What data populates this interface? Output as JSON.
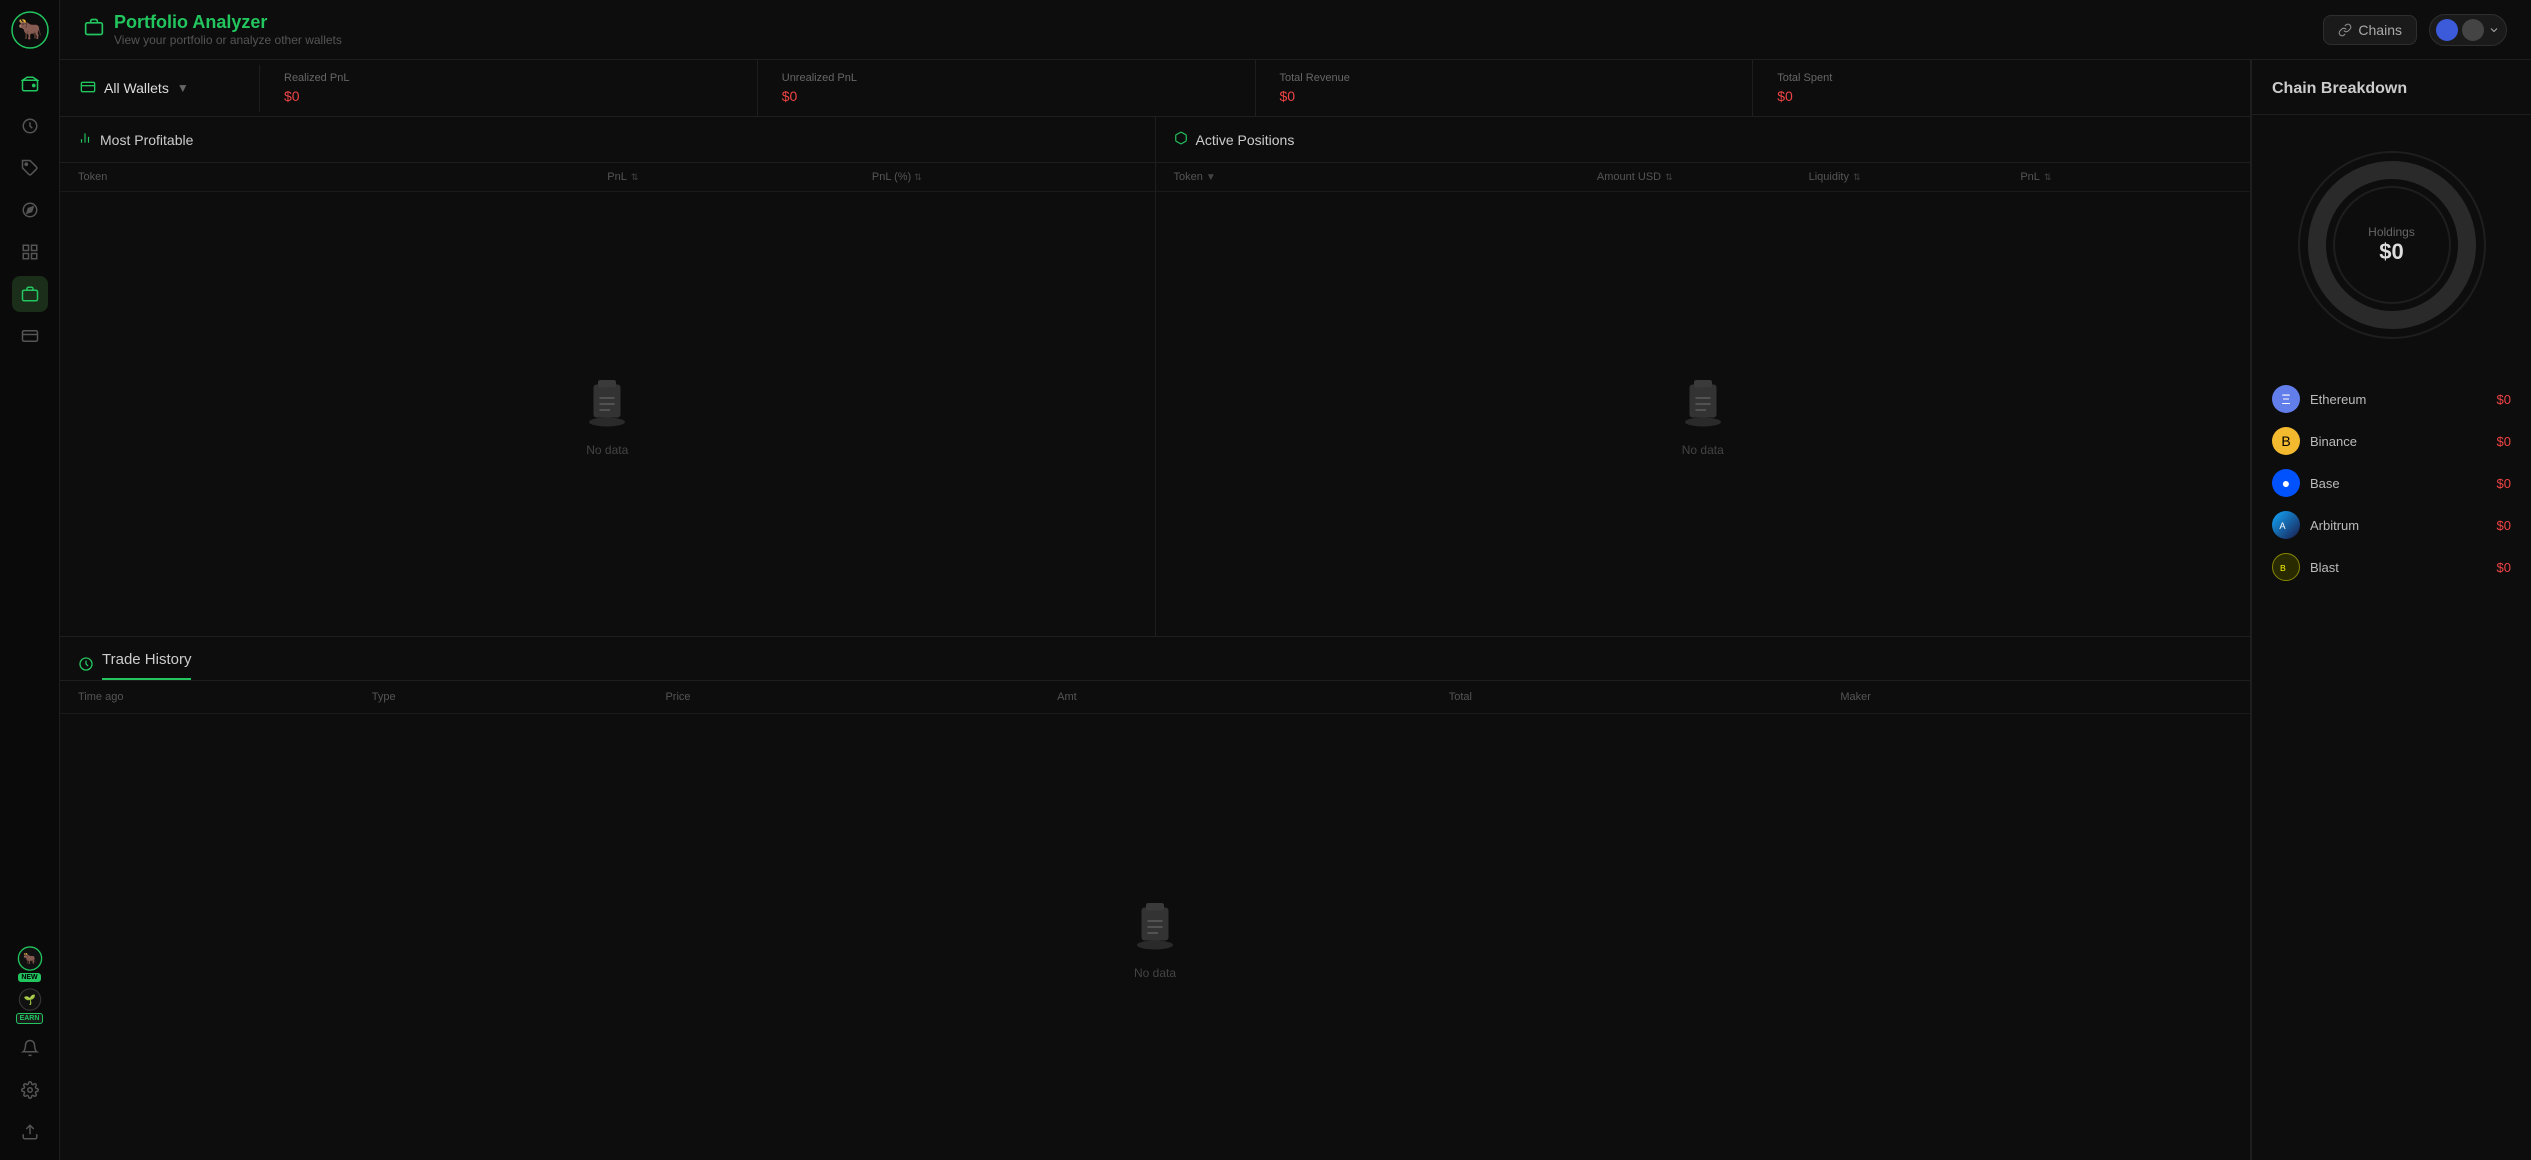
{
  "app": {
    "logo_alt": "Bull logo"
  },
  "sidebar": {
    "items": [
      {
        "id": "wallet",
        "icon": "💳",
        "label": "Wallet"
      },
      {
        "id": "history",
        "icon": "🕐",
        "label": "History"
      },
      {
        "id": "tag",
        "icon": "🏷️",
        "label": "Tag"
      },
      {
        "id": "compass",
        "icon": "🧭",
        "label": "Compass"
      },
      {
        "id": "crop",
        "icon": "⊞",
        "label": "Crop"
      },
      {
        "id": "briefcase",
        "icon": "💼",
        "label": "Briefcase",
        "active": true
      },
      {
        "id": "card",
        "icon": "🪪",
        "label": "Card"
      },
      {
        "id": "new-feature",
        "badge": "NEW",
        "icon": "🐂"
      },
      {
        "id": "earn-feature",
        "badge": "EARN",
        "icon": "🌱"
      },
      {
        "id": "bell",
        "icon": "🔔",
        "label": "Bell"
      },
      {
        "id": "settings",
        "icon": "⚙️",
        "label": "Settings"
      },
      {
        "id": "export",
        "icon": "📤",
        "label": "Export"
      }
    ]
  },
  "header": {
    "title": "Portfolio Analyzer",
    "subtitle": "View your portfolio or analyze other wallets",
    "chains_button": "Chains",
    "icon_alt": "portfolio-icon"
  },
  "wallet_bar": {
    "wallet_label": "All Wallets",
    "stats": [
      {
        "label": "Realized PnL",
        "value": "$0"
      },
      {
        "label": "Unrealized PnL",
        "value": "$0"
      },
      {
        "label": "Total Revenue",
        "value": "$0"
      },
      {
        "label": "Total Spent",
        "value": "$0"
      }
    ]
  },
  "most_profitable": {
    "title": "Most Profitable",
    "columns": [
      {
        "key": "token",
        "label": "Token"
      },
      {
        "key": "pnl",
        "label": "PnL",
        "sortable": true
      },
      {
        "key": "pnlpct",
        "label": "PnL (%)",
        "sortable": true
      }
    ],
    "no_data": "No data"
  },
  "active_positions": {
    "title": "Active Positions",
    "columns": [
      {
        "key": "token",
        "label": "Token",
        "filterable": true
      },
      {
        "key": "amount_usd",
        "label": "Amount USD",
        "sortable": true
      },
      {
        "key": "liquidity",
        "label": "Liquidity",
        "sortable": true
      },
      {
        "key": "pnl",
        "label": "PnL",
        "sortable": true
      }
    ],
    "no_data": "No data"
  },
  "trade_history": {
    "title": "Trade History",
    "columns": [
      {
        "key": "time_ago",
        "label": "Time ago"
      },
      {
        "key": "type",
        "label": "Type"
      },
      {
        "key": "price",
        "label": "Price"
      },
      {
        "key": "amt",
        "label": "Amt"
      },
      {
        "key": "total",
        "label": "Total"
      },
      {
        "key": "maker",
        "label": "Maker"
      }
    ],
    "no_data": "No data"
  },
  "chain_breakdown": {
    "title": "Chain Breakdown",
    "holdings_label": "Holdings",
    "holdings_value": "$0",
    "donut_empty_color": "#2a2a2a",
    "chains": [
      {
        "id": "ethereum",
        "name": "Ethereum",
        "value": "$0",
        "icon_type": "eth",
        "icon_char": "Ξ"
      },
      {
        "id": "binance",
        "name": "Binance",
        "value": "$0",
        "icon_type": "bnb",
        "icon_char": "B"
      },
      {
        "id": "base",
        "name": "Base",
        "value": "$0",
        "icon_type": "base",
        "icon_char": "●"
      },
      {
        "id": "arbitrum",
        "name": "Arbitrum",
        "value": "$0",
        "icon_type": "arb",
        "icon_char": "ARB"
      },
      {
        "id": "blast",
        "name": "Blast",
        "value": "$0",
        "icon_type": "blast",
        "icon_char": "B"
      }
    ]
  }
}
